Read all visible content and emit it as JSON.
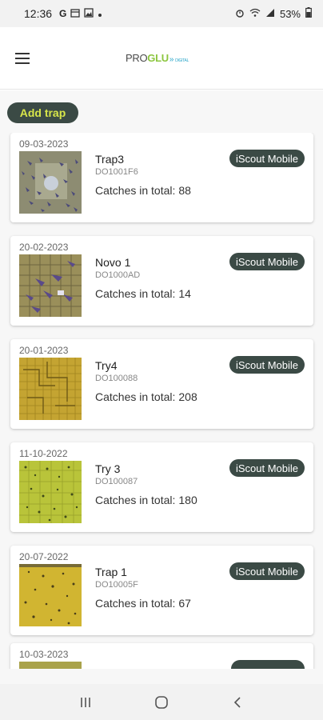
{
  "status_bar": {
    "time": "12:36",
    "icons": [
      "google-icon",
      "calendar-icon",
      "image-icon",
      "dot-icon"
    ],
    "battery": "53%",
    "right_icons": [
      "alarm-icon",
      "wifi-icon",
      "signal-icon",
      "battery-icon"
    ]
  },
  "app_bar": {
    "logo_pro": "PRO",
    "logo_glu": "GLU",
    "logo_arrows": "»",
    "logo_sub": "DIGITAL"
  },
  "actions": {
    "add_trap": "Add trap"
  },
  "traps": [
    {
      "date": "09-03-2023",
      "name": "Trap3",
      "code": "DO1001F6",
      "catches_label": "Catches in total:",
      "catches": "88",
      "badge": "iScout Mobile",
      "thumb": "purple"
    },
    {
      "date": "20-02-2023",
      "name": "Novo 1",
      "code": "DO1000AD",
      "catches_label": "Catches in total:",
      "catches": "14",
      "badge": "iScout Mobile",
      "thumb": "grid-purple"
    },
    {
      "date": "20-01-2023",
      "name": "Try4",
      "code": "DO100088",
      "catches_label": "Catches in total:",
      "catches": "208",
      "badge": "iScout Mobile",
      "thumb": "yellow-grid"
    },
    {
      "date": "11-10-2022",
      "name": "Try 3",
      "code": "DO100087",
      "catches_label": "Catches in total:",
      "catches": "180",
      "badge": "iScout Mobile",
      "thumb": "lime-grid"
    },
    {
      "date": "20-07-2022",
      "name": "Trap 1",
      "code": "DO10005F",
      "catches_label": "Catches in total:",
      "catches": "67",
      "badge": "iScout Mobile",
      "thumb": "yellow-dots"
    },
    {
      "date": "10-03-2023",
      "name": "",
      "code": "",
      "catches_label": "",
      "catches": "",
      "badge": "",
      "thumb": "partial"
    }
  ],
  "colors": {
    "accent_dark": "#3b4a45",
    "accent_yellow": "#d8e64a",
    "logo_green": "#8cc63f",
    "logo_blue": "#2aa6c9"
  },
  "nav": {
    "recents": "recents-icon",
    "home": "home-icon",
    "back": "back-icon"
  }
}
